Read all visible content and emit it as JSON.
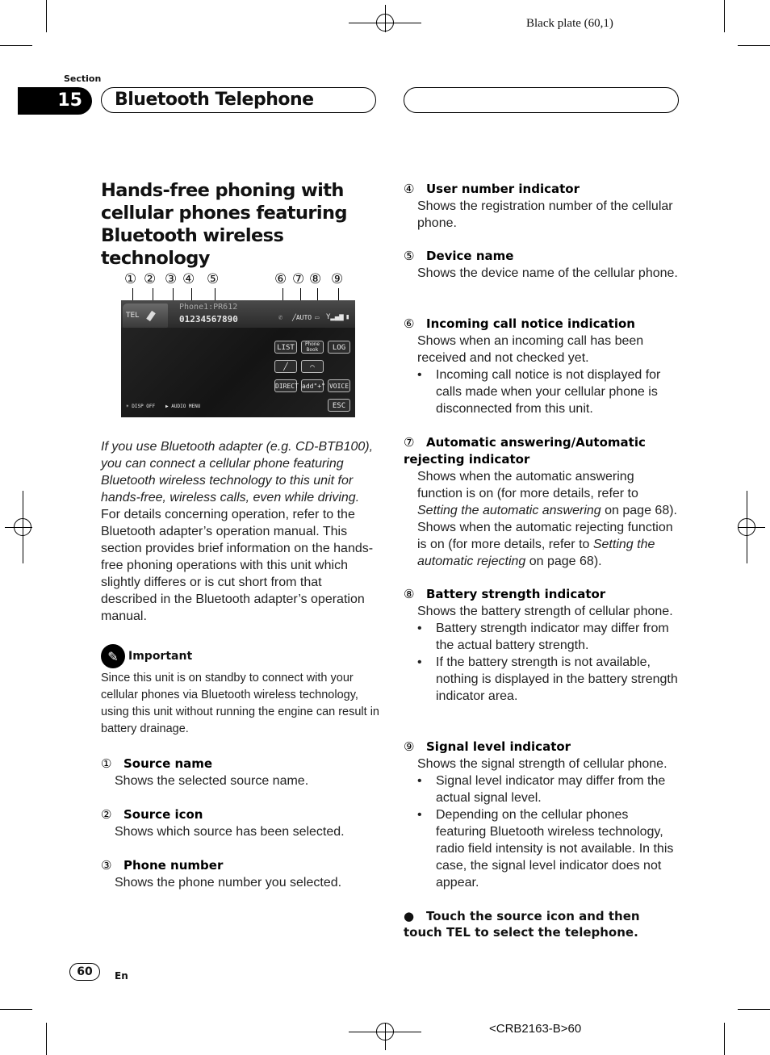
{
  "print_marks": {
    "plate_label": "Black plate (60,1)",
    "job_code": "<CRB2163-B>60"
  },
  "header": {
    "section_label": "Section",
    "section_number": "15",
    "section_title": "Bluetooth Telephone",
    "right_pill_text": ""
  },
  "heading": "Hands-free phoning with cellular phones featuring Bluetooth wireless technology",
  "screen": {
    "callouts": [
      "①",
      "②",
      "③",
      "④",
      "⑤",
      "⑥",
      "⑦",
      "⑧",
      "⑨"
    ],
    "source_name": "TEL",
    "user_device": "Phone1:PR612",
    "phone_number": "01234567890",
    "auto_indicator": "AUTO",
    "buttons": {
      "list": "LIST",
      "phone_book": "Phone Book",
      "log": "LOG",
      "direct": "DIRECT",
      "add_plus": "add\"+\"",
      "voice": "VOICE",
      "esc": "ESC"
    },
    "disp_off": "DISP OFF",
    "audio_menu": "AUDIO MENU"
  },
  "intro": {
    "italic": "If you use Bluetooth adapter (e.g. CD-BTB100), you can connect a cellular phone featuring Bluetooth wireless technology to this unit for hands-free, wireless calls, even while driving.",
    "plain": "For details concerning operation, refer to the Bluetooth adapter’s operation manual. This section provides brief information on the hands-free phoning operations with this unit which slightly differes or is cut short from that described in the Bluetooth adapter’s operation manual."
  },
  "important": {
    "title": "Important",
    "text": "Since this unit is on standby to connect with your cellular phones via Bluetooth wireless technology, using this unit without running the engine can result in battery drainage."
  },
  "items": [
    {
      "num": "①",
      "title": "Source name",
      "desc": "Shows the selected source name."
    },
    {
      "num": "②",
      "title": "Source icon",
      "desc": "Shows which source has been selected."
    },
    {
      "num": "③",
      "title": "Phone number",
      "desc": "Shows the phone number you selected."
    },
    {
      "num": "④",
      "title": "User number indicator",
      "desc": "Shows the registration number of the cellular phone."
    },
    {
      "num": "⑤",
      "title": "Device name",
      "desc": "Shows the device name of the cellular phone."
    },
    {
      "num": "⑥",
      "title": "Incoming call notice indication",
      "desc": "Shows when an incoming call has been received and not checked yet.",
      "bullets": [
        "Incoming call notice is not displayed for calls made when your cellular phone is disconnected from this unit."
      ]
    },
    {
      "num": "⑦",
      "title": "Automatic answering/Automatic rejecting indicator",
      "desc_parts": {
        "a1": "Shows when the automatic answering function is on (for more details, refer to ",
        "a_link": "Setting the automatic answering",
        "a2": " on page 68).",
        "b1": "Shows when the automatic rejecting function is on (for more details, refer to ",
        "b_link": "Setting the automatic rejecting",
        "b2": " on page 68)."
      }
    },
    {
      "num": "⑧",
      "title": "Battery strength indicator",
      "desc": "Shows the battery strength of cellular phone.",
      "bullets": [
        "Battery strength indicator may differ from the actual battery strength.",
        "If the battery strength is not available, nothing is displayed in the battery strength indicator area."
      ]
    },
    {
      "num": "⑨",
      "title": "Signal level indicator",
      "desc": "Shows the signal strength of cellular phone.",
      "bullets": [
        "Signal level indicator may differ from the actual signal level.",
        "Depending on the cellular phones featuring Bluetooth wireless technology, radio field intensity is not available. In this case, the signal level indicator does not appear."
      ]
    }
  ],
  "step": {
    "bullet": "●",
    "text": "Touch the source icon and then touch TEL to select the telephone."
  },
  "footer": {
    "page_number": "60",
    "language": "En"
  }
}
